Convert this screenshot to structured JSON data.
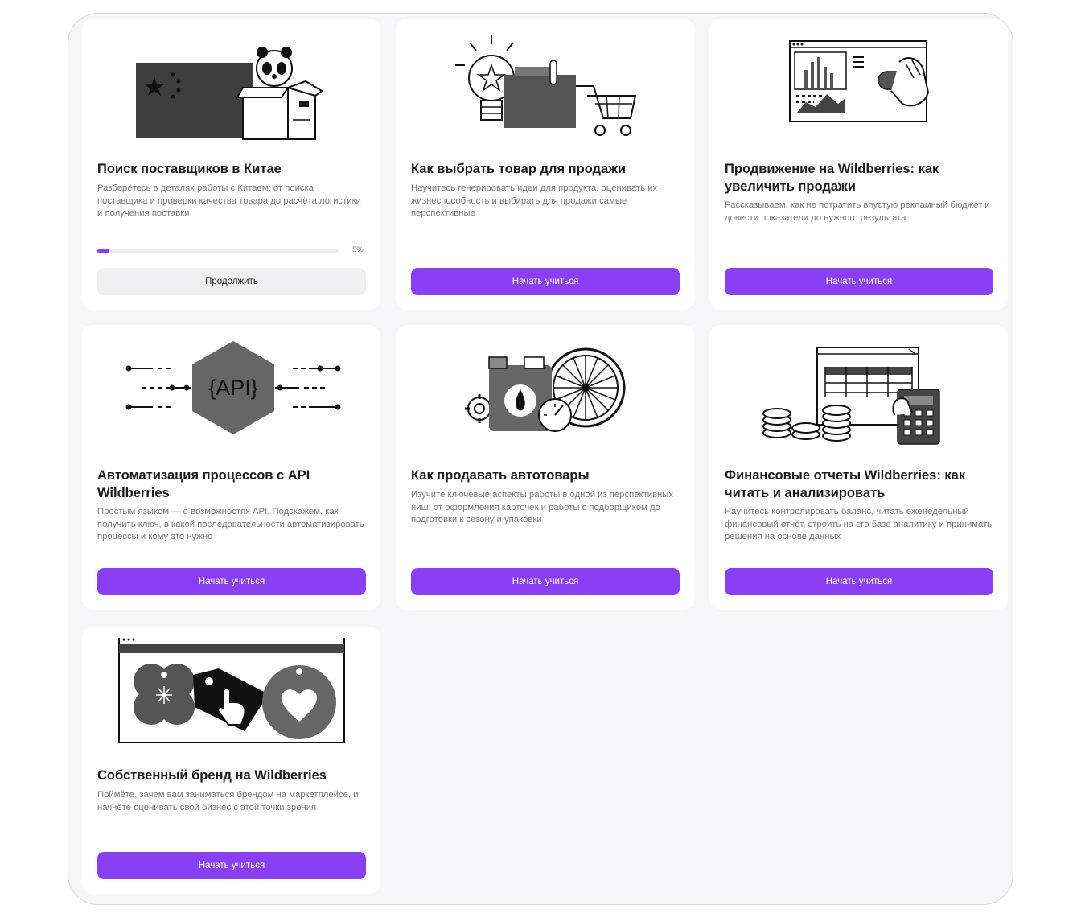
{
  "courses": [
    {
      "title": "Поиск поставщиков в Китае",
      "description": "Разберётесь в деталях работы с Китаем: от поиска поставщика и проверки качества товара до расчёта логистики и получения поставки",
      "progress": 5,
      "progress_label": "5%",
      "button_label": "Продолжить",
      "illustration": "china-flag-panda-box-icon"
    },
    {
      "title": "Как выбрать товар для продажи",
      "description": "Научитесь генерировать идеи для продукта, оценивать их жизнеспособность и выбирать для продажи самые перспективные",
      "button_label": "Начать учиться",
      "illustration": "lightbulb-folder-cart-icon"
    },
    {
      "title": "Продвижение на Wildberries: как увеличить продажи",
      "description": "Рассказываем, как не потратить впустую рекламный бюджет и довести показатели до нужного результата",
      "button_label": "Начать учиться",
      "illustration": "dashboard-toggle-hand-icon"
    },
    {
      "title": "Автоматизация процессов с API Wildberries",
      "description": "Простым языком — о возможностях API. Подскажем, как получить ключ, в какой последовательности автоматизировать процессы и кому это нужно",
      "button_label": "Начать учиться",
      "illustration": "api-hexagon-icon",
      "illustration_text": "{API}"
    },
    {
      "title": "Как продавать автотовары",
      "description": "Изучите ключевые аспекты работы в одной из перспективных ниш: от оформления карточек и работы с подборщиком до подготовки к сезону и упаковки",
      "button_label": "Начать учиться",
      "illustration": "canister-wheel-gear-icon"
    },
    {
      "title": "Финансовые отчеты Wildberries: как читать и анализировать",
      "description": "Научитесь контролировать баланс, читать еженедельный финансовый отчёт, строить на его базе аналитику и принимать решения на основе данных",
      "button_label": "Начать учиться",
      "illustration": "spreadsheet-coins-calculator-icon"
    },
    {
      "title": "Собственный бренд на Wildberries",
      "description": "Поймёте, зачем вам заниматься брендом на маркетплейсе, и начнёте оценивать свой бизнес с этой точки зрения",
      "button_label": "Начать учиться",
      "illustration": "brand-tags-heart-icon"
    }
  ],
  "colors": {
    "accent": "#8b3ff5",
    "secondary_button": "#efeff1",
    "page": "#f6f6f8",
    "card": "#ffffff"
  }
}
